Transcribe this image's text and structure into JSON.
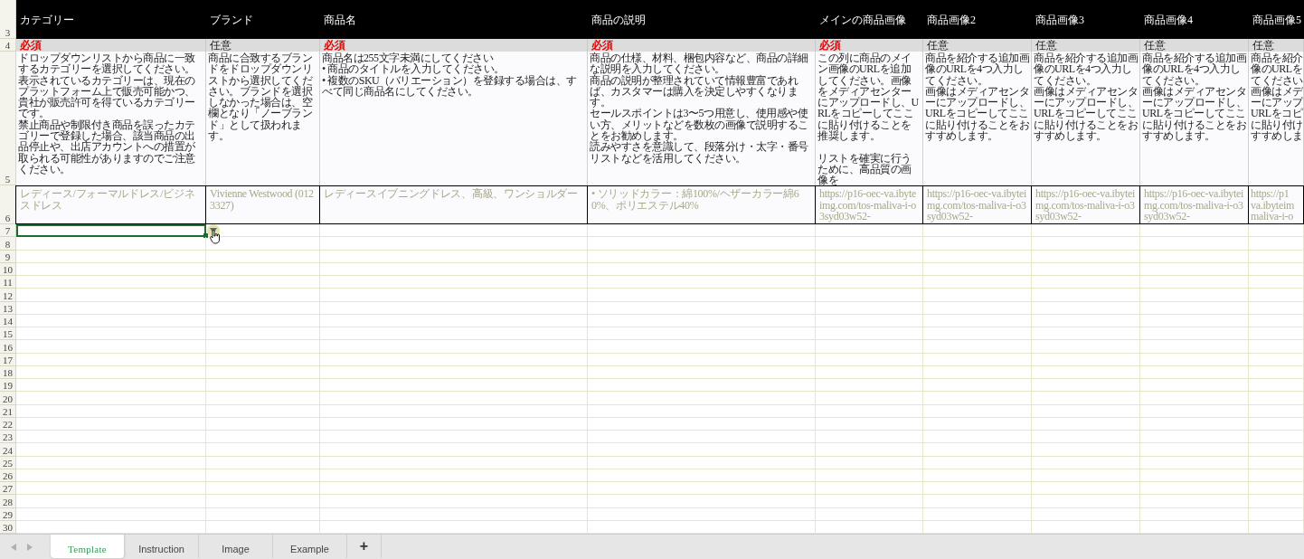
{
  "row_numbers": {
    "header": "3",
    "requirement": "4",
    "description": "5",
    "sample": "6"
  },
  "columns": [
    {
      "header": "カテゴリー",
      "requirement": {
        "text": "必須",
        "required": true
      },
      "description": [
        "ドロップダウンリストから商品に一致するカテゴリーを選択してください。表示されているカテゴリーは、現在のプラットフォーム上で販売可能かつ、貴社が販売許可を得ているカテゴリーです。",
        "禁止商品や制限付き商品を誤ったカテゴリーで登録した場合、該当商品の出品停止や、出店アカウントへの措置が取られる可能性がありますのでご注意ください。"
      ],
      "sample": "レディース/フォーマルドレス/ビジネスドレス"
    },
    {
      "header": "ブランド",
      "requirement": {
        "text": "任意",
        "required": false
      },
      "description": [
        "商品に合致するブランドをドロップダウンリストから選択してください。ブランドを選択しなかった場合は、空欄となり「ノーブランド」として扱われます。"
      ],
      "sample": "Vivienne Westwood (0123327)"
    },
    {
      "header": "商品名",
      "requirement": {
        "text": "必須",
        "required": true
      },
      "description": [
        "商品名は255文字未満にしてください",
        "• 商品のタイトルを入力してください。",
        "• 複数のSKU（バリエーション）を登録する場合は、すべて同じ商品名にしてください。"
      ],
      "sample": "レディースイブニングドレス、高級、ワンショルダー"
    },
    {
      "header": "商品の説明",
      "requirement": {
        "text": "必須",
        "required": true
      },
      "description": [
        "商品の仕様、材料、梱包内容など、商品の詳細な説明を入力してください。",
        "商品の説明が整理されていて情報豊富であれば、カスタマーは購入を決定しやすくなります。",
        "セールスポイントは3〜5つ用意し、使用感や使い方、メリットなどを数枚の画像で説明することをお勧めします。",
        "読みやすさを意識して、段落分け・太字・番号リストなどを活用してください。"
      ],
      "sample": "• ソリッドカラー：綿100%/ヘザーカラー綿60%、ポリエステル40%"
    },
    {
      "header": "メインの商品画像",
      "requirement": {
        "text": "必須",
        "required": true
      },
      "description": [
        "この列に商品のメイン画像のURLを追加してください。画像をメディアセンターにアップロードし、URLをコピーしてここに貼り付けることを推奨します。",
        {
          "text": "リストを確実に行うために、高品質の画像を",
          "spaced": true
        }
      ],
      "sample": "https://p16-oec-va.ibyteimg.com/tos-maliva-i-o3syd03w52-"
    },
    {
      "header": "商品画像2",
      "requirement": {
        "text": "任意",
        "required": false
      },
      "description": [
        "商品を紹介する追加画像のURLを4つ入力してください。",
        "画像はメディアセンターにアップロードし、URLをコピーしてここに貼り付けることをおすすめします。"
      ],
      "sample": "https://p16-oec-va.ibyteimg.com/tos-maliva-i-o3syd03w52-"
    },
    {
      "header": "商品画像3",
      "requirement": {
        "text": "任意",
        "required": false
      },
      "description": [
        "商品を紹介する追加画像のURLを4つ入力してください。",
        "画像はメディアセンターにアップロードし、URLをコピーしてここに貼り付けることをおすすめします。"
      ],
      "sample": "https://p16-oec-va.ibyteimg.com/tos-maliva-i-o3syd03w52-"
    },
    {
      "header": "商品画像4",
      "requirement": {
        "text": "任意",
        "required": false
      },
      "description": [
        "商品を紹介する追加画像のURLを4つ入力してください。",
        "画像はメディアセンターにアップロードし、URLをコピーしてここに貼り付けることをおすすめします。"
      ],
      "sample": "https://p16-oec-va.ibyteimg.com/tos-maliva-i-o3syd03w52-"
    },
    {
      "header": "商品画像5",
      "requirement": {
        "text": "任意",
        "required": false
      },
      "description_lines": [
        "商品を紹介",
        "像のURLを",
        "てください",
        "画像はメデ",
        "ーにアップ",
        "URLをコピ",
        "に貼り付け",
        "すすめしま"
      ],
      "sample_lines": [
        "https://p1",
        "va.ibyteim",
        "maliva-i-o"
      ]
    }
  ],
  "empty_rows": [
    {
      "number": "7",
      "selected": true
    },
    {
      "number": "8",
      "selected": false
    },
    {
      "number": "9",
      "selected": false
    },
    {
      "number": "10",
      "selected": false
    },
    {
      "number": "11",
      "selected": false
    },
    {
      "number": "12",
      "selected": false
    },
    {
      "number": "13",
      "selected": false
    },
    {
      "number": "14",
      "selected": false
    },
    {
      "number": "15",
      "selected": false
    },
    {
      "number": "16",
      "selected": false
    },
    {
      "number": "17",
      "selected": false
    },
    {
      "number": "18",
      "selected": false
    },
    {
      "number": "19",
      "selected": false
    },
    {
      "number": "20",
      "selected": false
    },
    {
      "number": "21",
      "selected": false
    },
    {
      "number": "22",
      "selected": false
    },
    {
      "number": "23",
      "selected": false
    },
    {
      "number": "24",
      "selected": false
    },
    {
      "number": "25",
      "selected": false
    },
    {
      "number": "26",
      "selected": false
    },
    {
      "number": "27",
      "selected": false
    },
    {
      "number": "28",
      "selected": false
    },
    {
      "number": "29",
      "selected": false
    },
    {
      "number": "30",
      "selected": false
    }
  ],
  "sheet_tabs": [
    {
      "label": "Template",
      "selected": true
    },
    {
      "label": "Instruction",
      "selected": false
    },
    {
      "label": "Image",
      "selected": false
    },
    {
      "label": "Example",
      "selected": false
    }
  ],
  "add_sheet": "+"
}
